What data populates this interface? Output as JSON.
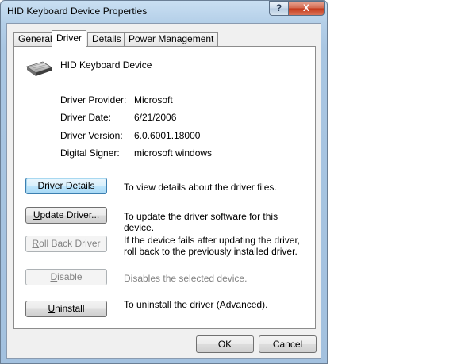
{
  "window": {
    "title": "HID Keyboard Device Properties",
    "help_glyph": "?",
    "close_glyph": "X"
  },
  "tabs": [
    {
      "label": "General"
    },
    {
      "label": "Driver",
      "active": true
    },
    {
      "label": "Details"
    },
    {
      "label": "Power Management"
    }
  ],
  "device": {
    "name": "HID Keyboard Device",
    "icon": "keyboard-icon"
  },
  "info": [
    {
      "label": "Driver Provider:",
      "value": "Microsoft"
    },
    {
      "label": "Driver Date:",
      "value": "6/21/2006"
    },
    {
      "label": "Driver Version:",
      "value": "6.0.6001.18000"
    },
    {
      "label": "Digital Signer:",
      "value": "microsoft windows"
    }
  ],
  "actions": [
    {
      "button": "Driver Details",
      "mnemonic": "",
      "description": "To view details about the driver files.",
      "enabled": true
    },
    {
      "button": "Update Driver...",
      "mnemonic": "U",
      "description": "To update the driver software for this device.",
      "enabled": true
    },
    {
      "button": "Roll Back Driver",
      "mnemonic": "R",
      "description": "If the device fails after updating the driver, roll back to the previously installed driver.",
      "enabled": false
    },
    {
      "button": "Disable",
      "mnemonic": "D",
      "description": "Disables the selected device.",
      "enabled": false
    },
    {
      "button": "Uninstall",
      "mnemonic": "U",
      "description": "To uninstall the driver (Advanced).",
      "enabled": true
    }
  ],
  "footer": {
    "ok_label": "OK",
    "cancel_label": "Cancel"
  }
}
